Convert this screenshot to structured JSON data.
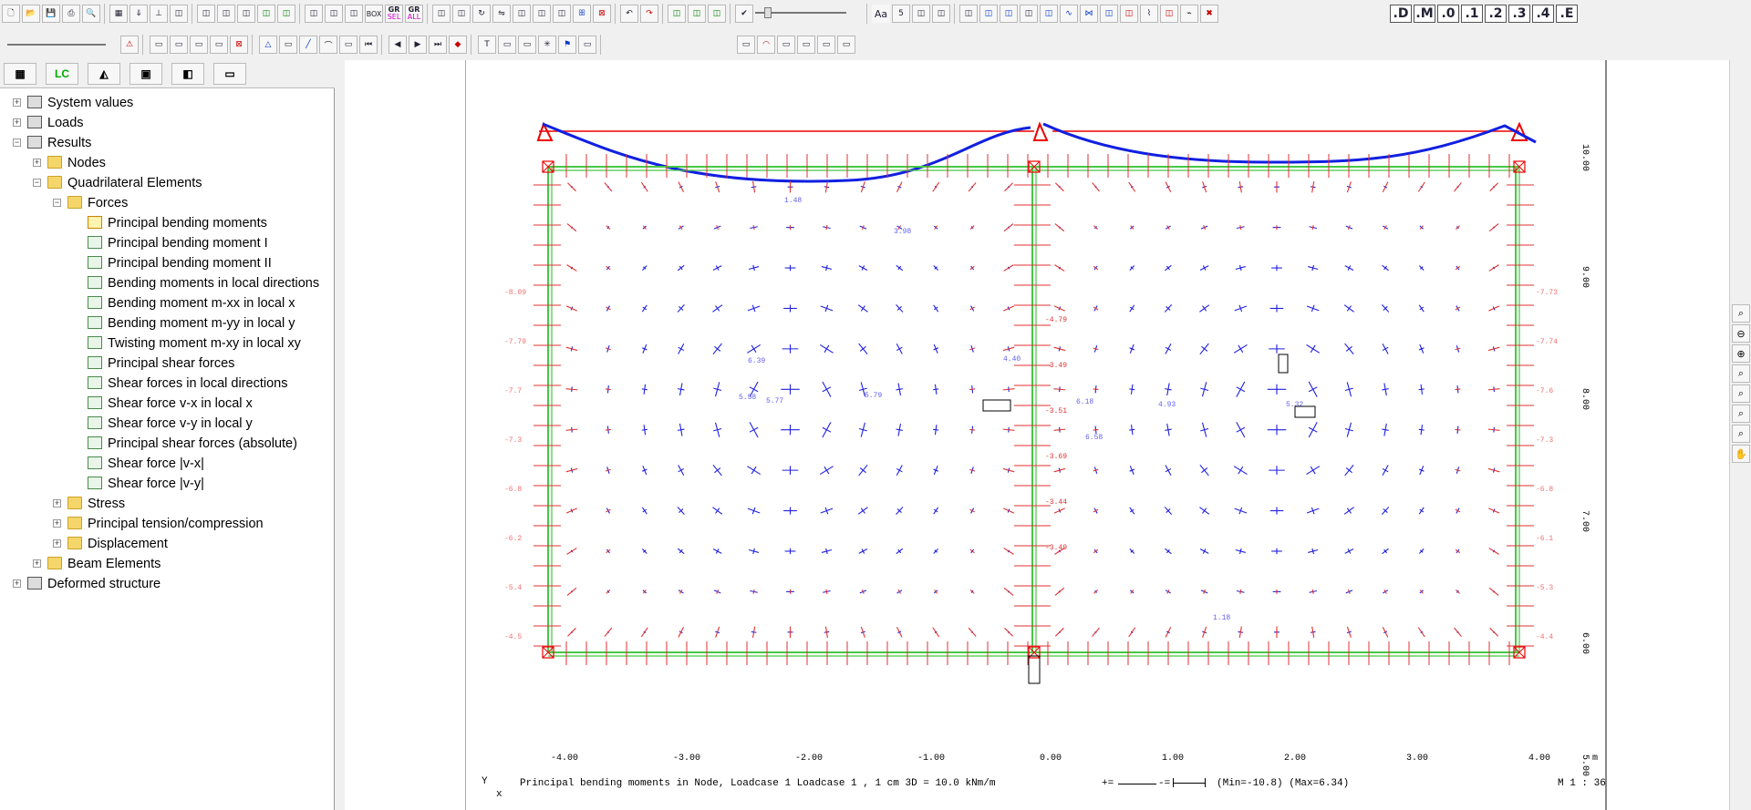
{
  "toolbar1": {
    "buttons": [
      "new-icon",
      "open-icon",
      "save-icon",
      "print-icon",
      "print-preview-icon",
      "grid-icon",
      "load-arrow-icon",
      "support-icon",
      "hinge-icon",
      "spring-icon",
      "elastic-icon",
      "frame-icon",
      "mesh-icon",
      "element-icon",
      "color-icon",
      "copy-icon",
      "paste-icon",
      "box-icon",
      "gr-icon",
      "gr-all-icon",
      "move-x-icon",
      "move-y-icon",
      "rotate-icon",
      "mirror-icon",
      "scale-icon",
      "split-icon",
      "merge-icon",
      "butterfly-icon",
      "delete-icon",
      "undo-icon",
      "redo-icon",
      "view1-icon",
      "view2-icon",
      "view3-icon",
      "checkbox-icon",
      "slider-icon",
      "font-icon",
      "five-icon",
      "pan-icon",
      "calc-icon",
      "results-icon",
      "beam-icon",
      "shell-icon",
      "load-icon",
      "deflection-icon",
      "moment-icon",
      "shear-icon",
      "normal-icon",
      "support-r-icon",
      "diagram-icon",
      "stress-icon",
      "path-icon",
      "cross-icon"
    ],
    "decimals": [
      ".D",
      ".M",
      ".0",
      ".1",
      ".2",
      ".3",
      ".4",
      ".E"
    ],
    "gr_label": "GR",
    "gr_sub": "SEL",
    "gr_all_sub": "ALL",
    "box_label": "BOX",
    "font_label": "Aa"
  },
  "tree_tabs": [
    "structure-tab",
    "LC",
    "results-tab",
    "view-tab",
    "layers-tab",
    "folder-tab"
  ],
  "tree": [
    {
      "label": "System values",
      "level": 0,
      "expander": "+",
      "icon": "grid-icon"
    },
    {
      "label": "Loads",
      "level": 0,
      "expander": "+",
      "icon": "load-icon"
    },
    {
      "label": "Results",
      "level": 0,
      "expander": "−",
      "icon": "results-icon"
    },
    {
      "label": "Nodes",
      "level": 1,
      "expander": "+",
      "icon": "folder-icon"
    },
    {
      "label": "Quadrilateral Elements",
      "level": 1,
      "expander": "−",
      "icon": "folder-icon"
    },
    {
      "label": "Forces",
      "level": 2,
      "expander": "−",
      "icon": "folder-icon"
    },
    {
      "label": "Principal bending moments",
      "level": 3,
      "expander": "",
      "icon": "sheet-selected-icon"
    },
    {
      "label": "Principal bending moment I",
      "level": 3,
      "expander": "",
      "icon": "sheet-icon"
    },
    {
      "label": "Principal bending moment II",
      "level": 3,
      "expander": "",
      "icon": "sheet-icon"
    },
    {
      "label": "Bending moments in local directions",
      "level": 3,
      "expander": "",
      "icon": "sheet-icon"
    },
    {
      "label": "Bending moment m-xx in local x",
      "level": 3,
      "expander": "",
      "icon": "sheet-icon"
    },
    {
      "label": "Bending moment m-yy in local y",
      "level": 3,
      "expander": "",
      "icon": "sheet-icon"
    },
    {
      "label": "Twisting moment m-xy in local xy",
      "level": 3,
      "expander": "",
      "icon": "sheet-icon"
    },
    {
      "label": "Principal shear forces",
      "level": 3,
      "expander": "",
      "icon": "sheet-icon"
    },
    {
      "label": "Shear forces in local directions",
      "level": 3,
      "expander": "",
      "icon": "sheet-icon"
    },
    {
      "label": "Shear force v-x in local x",
      "level": 3,
      "expander": "",
      "icon": "sheet-icon"
    },
    {
      "label": "Shear force v-y in local y",
      "level": 3,
      "expander": "",
      "icon": "sheet-icon"
    },
    {
      "label": "Principal shear forces (absolute)",
      "level": 3,
      "expander": "",
      "icon": "sheet-icon"
    },
    {
      "label": "Shear force |v-x|",
      "level": 3,
      "expander": "",
      "icon": "sheet-icon"
    },
    {
      "label": "Shear force |v-y|",
      "level": 3,
      "expander": "",
      "icon": "sheet-icon"
    },
    {
      "label": "Stress",
      "level": 2,
      "expander": "+",
      "icon": "folder-icon"
    },
    {
      "label": "Principal tension/compression",
      "level": 2,
      "expander": "+",
      "icon": "folder-icon"
    },
    {
      "label": "Displacement",
      "level": 2,
      "expander": "+",
      "icon": "folder-icon"
    },
    {
      "label": "Beam Elements",
      "level": 1,
      "expander": "+",
      "icon": "folder-icon"
    },
    {
      "label": "Deformed structure",
      "level": 0,
      "expander": "+",
      "icon": "deformed-icon"
    }
  ],
  "axes": {
    "x_ticks": [
      "-4.00",
      "-3.00",
      "-2.00",
      "-1.00",
      "0.00",
      "1.00",
      "2.00",
      "3.00",
      "4.00"
    ],
    "x_unit": "m",
    "y_ticks": [
      "10.00",
      "9.00",
      "8.00",
      "7.00",
      "6.00",
      "5.00"
    ]
  },
  "labels": {
    "sample_left": [
      "-8.09",
      "-7.79",
      "-7.7",
      "-7.3",
      "-6.8",
      "-6.2",
      "-5.4",
      "-4.5"
    ],
    "sample_right": [
      "-7.73",
      "-7.74",
      "-7.6",
      "-7.3",
      "-6.8",
      "-6.1",
      "-5.3",
      "-4.4"
    ],
    "sample_mid": [
      "-4.79",
      "-3.49",
      "-3.51",
      "-3.69",
      "-3.44",
      "-3.49"
    ],
    "blue_values": [
      "6.39",
      "5.79",
      "5.77",
      "5.58",
      "6.18",
      "6.58",
      "1.48",
      "1.18",
      "5.32",
      "4.93",
      "4.40",
      "3.98"
    ]
  },
  "status": {
    "text": "Principal bending moments in Node, Loadcase 1 Loadcase 1   , 1 cm 3D = 10.0 kNm/m",
    "plus": "+=",
    "minus": "-=",
    "minmax": "(Min=-10.8)  (Max=6.34)",
    "scale": "M 1 : 36",
    "axis_y": "Y",
    "axis_x": "x"
  },
  "colors": {
    "plate_edge": "#46c846",
    "positive": "#2020e0",
    "negative": "#e03030",
    "label_pos": "#6060f0",
    "label_neg": "#f07070"
  }
}
